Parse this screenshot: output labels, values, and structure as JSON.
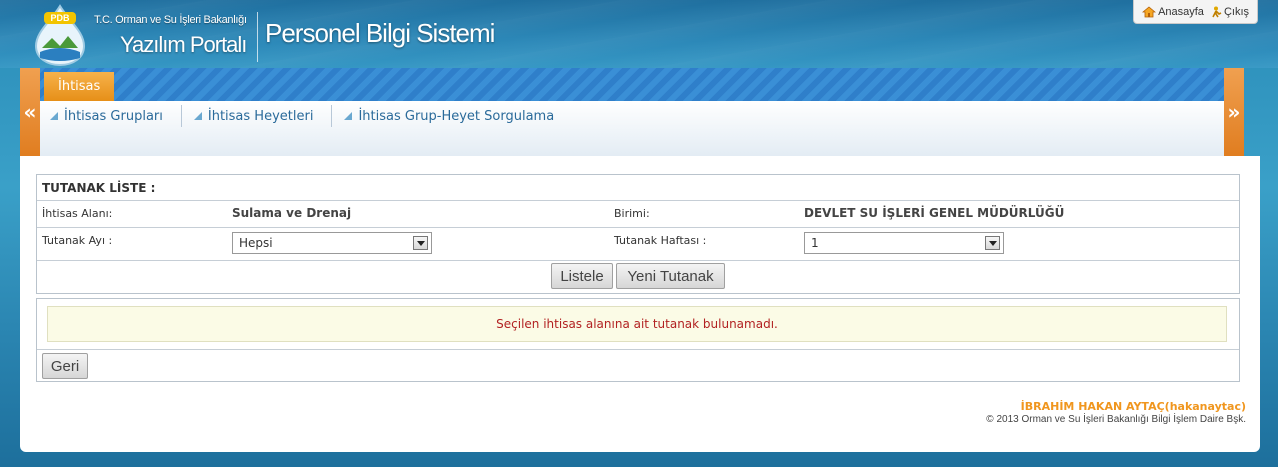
{
  "header": {
    "logo_text": "PDB",
    "ministry": "T.C. Orman ve Su İşleri Bakanlığı",
    "portal": "Yazılım Portalı",
    "app_title": "Personel Bilgi Sistemi",
    "links": [
      {
        "label": "Anasayfa",
        "icon": "home-icon"
      },
      {
        "label": "Çıkış",
        "icon": "exit-icon"
      }
    ]
  },
  "menu": {
    "active_tab": "İhtisas",
    "submenu": [
      "İhtisas Grupları",
      "İhtisas Heyetleri",
      "İhtisas Grup-Heyet Sorgulama"
    ],
    "arrow_left": "«",
    "arrow_right": "»"
  },
  "form": {
    "title": "TUTANAK LİSTE :",
    "ihtisas_label": "İhtisas Alanı:",
    "ihtisas_value": "Sulama ve Drenaj",
    "birim_label": "Birimi:",
    "birim_value": "DEVLET SU İŞLERİ GENEL MÜDÜRLÜĞÜ",
    "ay_label": "Tutanak Ayı :",
    "ay_value": "Hepsi",
    "hafta_label": "Tutanak Haftası :",
    "hafta_value": "1",
    "listele_label": "Listele",
    "yeni_label": "Yeni Tutanak"
  },
  "message": {
    "text": "Seçilen ihtisas alanına ait tutanak bulunamadı.",
    "geri_label": "Geri"
  },
  "footer": {
    "user": "İBRAHİM HAKAN AYTAÇ(hakanaytac)",
    "copyright": "© 2013 Orman ve Su İşleri Bakanlığı Bilgi İşlem Daire Bşk."
  },
  "colors": {
    "accent_orange": "#e68f18",
    "menu_blue": "#3a8fd6",
    "error_red": "#b22222"
  }
}
